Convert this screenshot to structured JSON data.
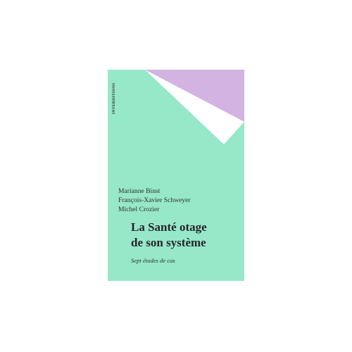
{
  "cover": {
    "collection": "INTERDITIONS",
    "authors": [
      "Marianne Binst",
      "François-Xavier Schweyer",
      "Michel Crozier"
    ],
    "title_lines": [
      "La Santé otage",
      "de son système"
    ],
    "subtitle": "Sept études de cas",
    "colors": {
      "background": "#96e8c9",
      "accent_purple": "#d2b3e2",
      "white_panel": "#ffffff"
    }
  }
}
